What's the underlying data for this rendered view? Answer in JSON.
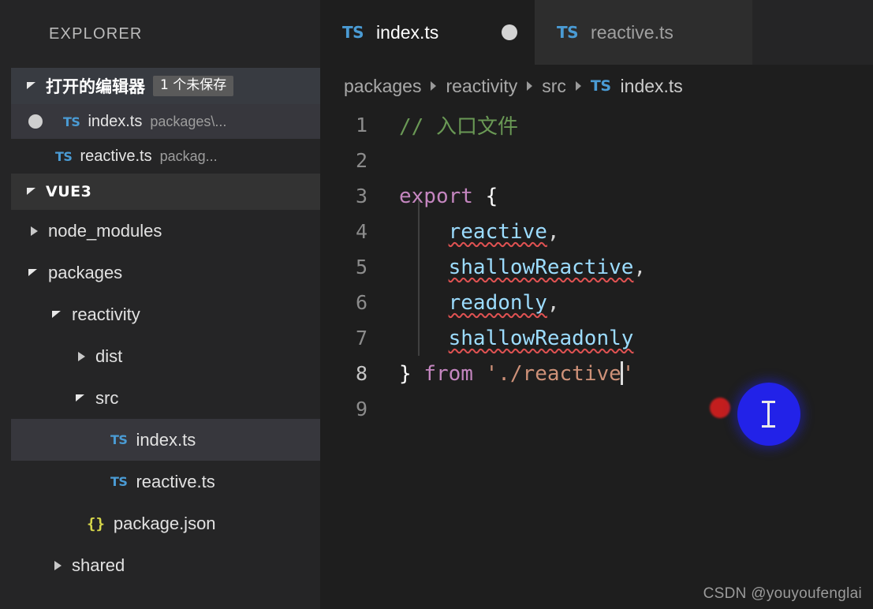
{
  "sidebar": {
    "title": "EXPLORER",
    "open_editors": {
      "label": "打开的编辑器",
      "badge": "1 个未保存",
      "items": [
        {
          "icon": "ts-icon",
          "name": "index.ts",
          "path": "packages\\...",
          "dirty": true,
          "selected": true
        },
        {
          "icon": "ts-icon",
          "name": "reactive.ts",
          "path": "packag...",
          "dirty": false,
          "selected": false
        }
      ]
    },
    "workspace": {
      "label": "VUE3",
      "tree": [
        {
          "label": "node_modules",
          "kind": "folder",
          "state": "collapsed",
          "depth": 1
        },
        {
          "label": "packages",
          "kind": "folder",
          "state": "expanded",
          "depth": 1
        },
        {
          "label": "reactivity",
          "kind": "folder",
          "state": "expanded",
          "depth": 2
        },
        {
          "label": "dist",
          "kind": "folder",
          "state": "collapsed",
          "depth": 3
        },
        {
          "label": "src",
          "kind": "folder",
          "state": "expanded",
          "depth": 3
        },
        {
          "label": "index.ts",
          "kind": "ts",
          "state": "file",
          "depth": 4,
          "selected": true
        },
        {
          "label": "reactive.ts",
          "kind": "ts",
          "state": "file",
          "depth": 4
        },
        {
          "label": "package.json",
          "kind": "json",
          "state": "file",
          "depth": 3
        },
        {
          "label": "shared",
          "kind": "folder",
          "state": "collapsed",
          "depth": 2
        }
      ]
    }
  },
  "editor": {
    "tabs": [
      {
        "icon": "ts-icon",
        "label": "index.ts",
        "active": true,
        "dirty": true
      },
      {
        "icon": "ts-icon",
        "label": "reactive.ts",
        "active": false,
        "dirty": false
      }
    ],
    "breadcrumbs": [
      "packages",
      "reactivity",
      "src",
      "index.ts"
    ],
    "breadcrumb_file_icon": "ts-icon",
    "line_numbers": [
      "1",
      "2",
      "3",
      "4",
      "5",
      "6",
      "7",
      "8",
      "9"
    ],
    "current_line": 8,
    "lines": [
      "// 入口文件",
      "",
      "export {",
      "    reactive,",
      "    shallowReactive,",
      "    readonly,",
      "    shallowReadonly",
      "} from './reactive'",
      ""
    ],
    "tokens": {
      "comment": "// 入口文件",
      "keyword_export": "export",
      "brace_open": "{",
      "ident_reactive": "reactive",
      "ident_shallowReactive": "shallowReactive",
      "ident_readonly": "readonly",
      "ident_shallowReadonly": "shallowReadonly",
      "comma": ",",
      "brace_close": "}",
      "keyword_from": "from",
      "string_module": "'./reactive'"
    }
  },
  "overlay": {
    "click_indicator": "mouse-click-ring",
    "cursor_glyph": "i-beam-cursor",
    "watermark": "CSDN @youyoufenglai"
  },
  "colors": {
    "background": "#1e1e1e",
    "sidebar": "#252526",
    "selected_row": "#37373d",
    "tab_inactive": "#2d2d2d",
    "ts_blue": "#4a9bd4",
    "comment_green": "#6a9955",
    "keyword_purple": "#c586c0",
    "ident_blue": "#9cdcfe",
    "string_orange": "#ce9178",
    "error_red": "#e05252",
    "click_blue": "#2222e8",
    "click_red": "#d21f1f"
  }
}
